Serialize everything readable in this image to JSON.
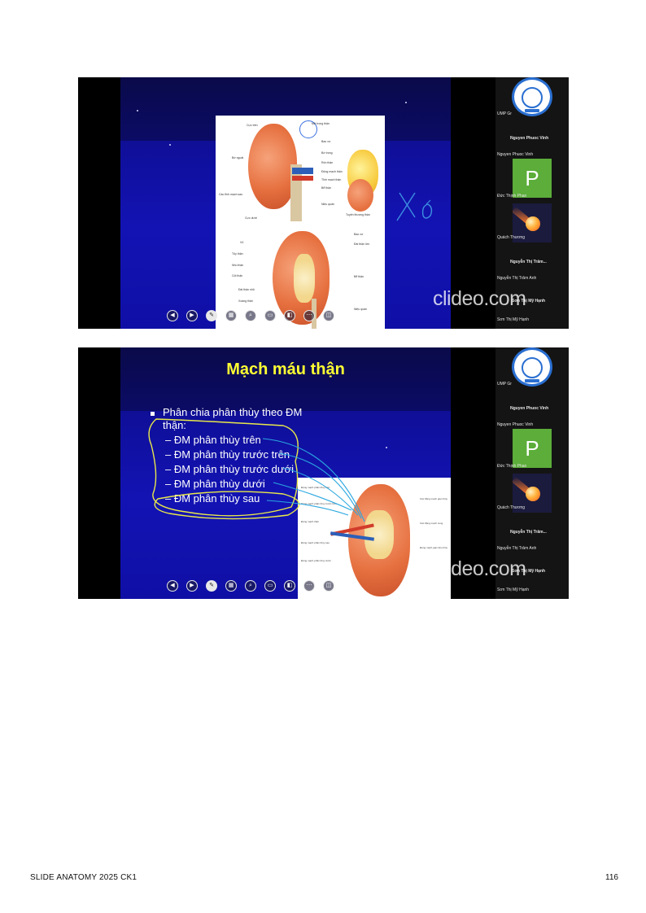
{
  "footer": {
    "doc_label": "SLIDE ANATOMY 2025 CK1",
    "page_number": "116"
  },
  "watermark": "clideo.com",
  "sidebar": {
    "participants": [
      "UMP Gr",
      "Nguyen Phuoc Vinh",
      "Nguyen Phuoc Vinh",
      "Đức Thịnh Phan",
      "Quách Thương",
      "Nguyễn Thị Trâm...",
      "Nguyễn Thị Trâm Anh",
      "Sơn Thị Mỹ Hạnh",
      "Sơn Thị Mỹ Hạnh"
    ],
    "avatar_letter": "P"
  },
  "slide1": {
    "handwriting": "Xơ",
    "labels_left": [
      "Cực trên",
      "Bờ ngoài",
      "Các tĩnh mạch sao",
      "Cực dưới"
    ],
    "labels_right": [
      "Mỡ trong thận",
      "Bao xơ",
      "Bờ trong",
      "Rốn thận",
      "Động mạch thận",
      "Tĩnh mạch thận",
      "Bể thận",
      "Niệu quản",
      "Tuyến thượng thận"
    ],
    "labels_section": [
      "Vỏ",
      "Tủy thận",
      "Nhú thận",
      "Cột thận",
      "Đài thận lớn",
      "Đài thận nhỏ",
      "Xoang thận",
      "Bể thận",
      "Niệu quản",
      "Bao xơ"
    ]
  },
  "slide2": {
    "title": "Mạch máu thận",
    "bullet": "Phân chia phân thùy theo ĐM thận:",
    "items": [
      "– ĐM phân thùy trên",
      "– ĐM phân thùy trước trên",
      "– ĐM phân thùy trước dưới",
      "– ĐM phân thùy dưới",
      "– ĐM phân thùy sau"
    ]
  }
}
